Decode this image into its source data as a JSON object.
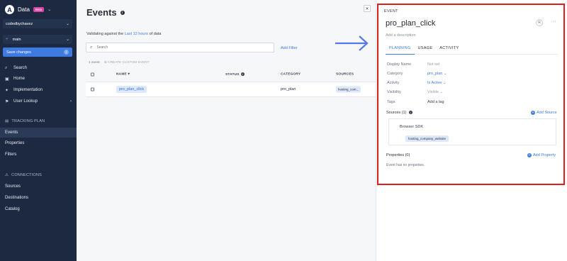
{
  "brand": {
    "title": "Data",
    "badge": "Beta"
  },
  "workspace": "codedbychavez",
  "branch": "main",
  "save_button": "Save changes",
  "nav": {
    "search": "Search",
    "home": "Home",
    "implementation": "Implementation",
    "user_lookup": "User Lookup"
  },
  "tracking_plan": {
    "heading": "TRACKING PLAN",
    "items": [
      "Events",
      "Properties",
      "Filters"
    ]
  },
  "connections": {
    "heading": "CONNECTIONS",
    "items": [
      "Sources",
      "Destinations",
      "Catalog"
    ]
  },
  "main": {
    "title": "Events",
    "validating_prefix": "Validating against the",
    "validating_link": "Last 12 hours",
    "validating_suffix": "of data",
    "search_placeholder": "Search",
    "add_filter": "Add Filter",
    "count": "1 event",
    "create_custom": "CREATE CUSTOM EVENT",
    "columns": {
      "name": "NAME",
      "status": "STATUS",
      "category": "CATEGORY",
      "sources": "SOURCES"
    },
    "rows": [
      {
        "name": "pro_plan_click",
        "category": "pro_plan",
        "source": "hosting_com..."
      }
    ]
  },
  "panel": {
    "label": "EVENT",
    "title": "pro_plan_click",
    "avatar": "R",
    "more": "···",
    "description_placeholder": "Add a description",
    "tabs": [
      "PLANNING",
      "USAGE",
      "ACTIVITY"
    ],
    "fields": {
      "display_name": {
        "label": "Display Name",
        "value": "Not set"
      },
      "category": {
        "label": "Category",
        "value": "pro_plan"
      },
      "activity": {
        "label": "Activity",
        "value": "Is Active"
      },
      "visibility": {
        "label": "Visibility",
        "value": "Visible"
      },
      "tags": {
        "label": "Tags",
        "value": "Add a tag"
      }
    },
    "sources_label": "Sources (1)",
    "add_source": "Add Source",
    "source_sdk": "Browser SDK",
    "source_tag": "hosting_company_website",
    "properties_label": "Properties (0)",
    "add_property": "Add Property",
    "no_properties": "Event has no properties."
  },
  "colors": {
    "sidebar": "#1c2940",
    "accent": "#3d7be0",
    "highlight": "#e11d1d",
    "beta": "#d946a8"
  }
}
